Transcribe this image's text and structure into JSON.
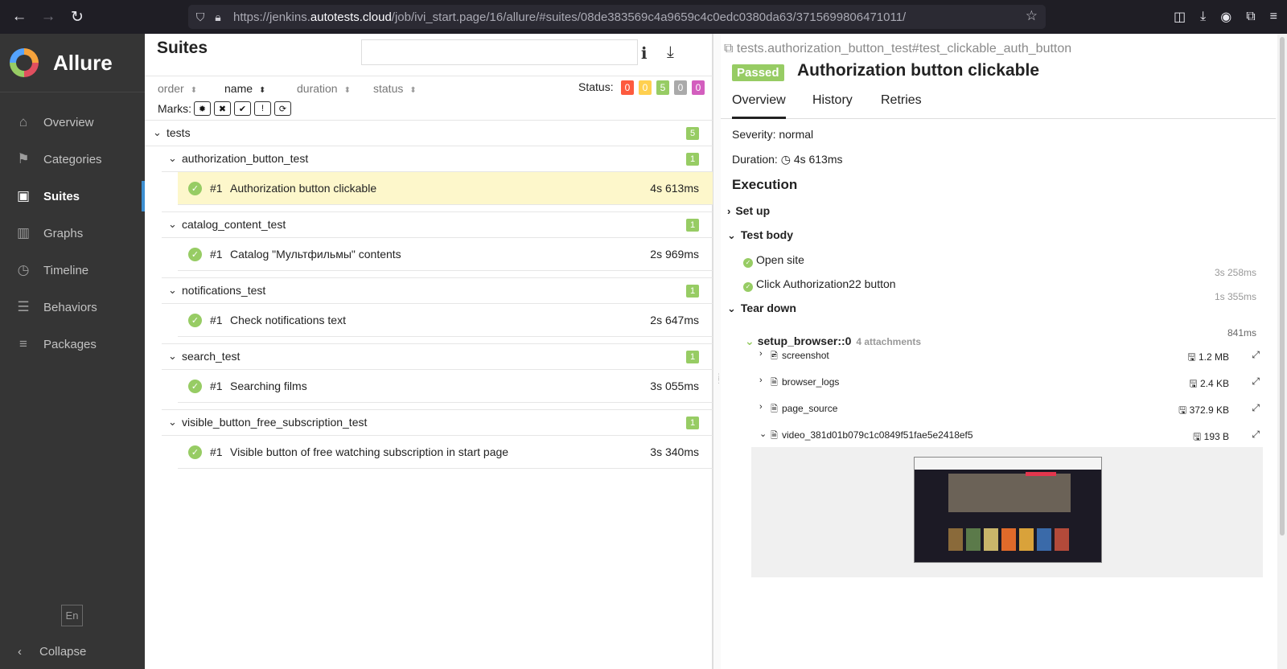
{
  "browser": {
    "url_prefix": "https://jenkins.",
    "url_host": "autotests.cloud",
    "url_path": "/job/ivi_start.page/16/allure/#suites/08de383569c4a9659c4c0edc0380da63/3715699806471011/"
  },
  "sidebar": {
    "logo": "Allure",
    "items": [
      {
        "label": "Overview",
        "icon": "home-icon"
      },
      {
        "label": "Categories",
        "icon": "flag-icon"
      },
      {
        "label": "Suites",
        "icon": "briefcase-icon"
      },
      {
        "label": "Graphs",
        "icon": "bar-chart-icon"
      },
      {
        "label": "Timeline",
        "icon": "clock-icon"
      },
      {
        "label": "Behaviors",
        "icon": "list-icon"
      },
      {
        "label": "Packages",
        "icon": "align-left-icon"
      }
    ],
    "language": "En",
    "collapse": "Collapse"
  },
  "suites": {
    "title": "Suites",
    "sort": {
      "order": "order",
      "name": "name",
      "duration": "duration",
      "status": "status"
    },
    "status_label": "Status:",
    "status_counts": [
      {
        "value": "0",
        "color": "#fd5a3e"
      },
      {
        "value": "0",
        "color": "#ffd050"
      },
      {
        "value": "5",
        "color": "#97cc64"
      },
      {
        "value": "0",
        "color": "#aaaaaa"
      },
      {
        "value": "0",
        "color": "#d35ebe"
      }
    ],
    "marks_label": "Marks:",
    "root": {
      "label": "tests",
      "count": "5"
    },
    "groups": [
      {
        "label": "authorization_button_test",
        "count": "1",
        "test": {
          "num": "#1",
          "name": "Authorization button clickable",
          "duration": "4s 613ms"
        }
      },
      {
        "label": "catalog_content_test",
        "count": "1",
        "test": {
          "num": "#1",
          "name": "Catalog \"Мультфильмы\" contents",
          "duration": "2s 969ms"
        }
      },
      {
        "label": "notifications_test",
        "count": "1",
        "test": {
          "num": "#1",
          "name": "Check notifications text",
          "duration": "2s 647ms"
        }
      },
      {
        "label": "search_test",
        "count": "1",
        "test": {
          "num": "#1",
          "name": "Searching films",
          "duration": "3s 055ms"
        }
      },
      {
        "label": "visible_button_free_subscription_test",
        "count": "1",
        "test": {
          "num": "#1",
          "name": "Visible button of free watching subscription in start page",
          "duration": "3s 340ms"
        }
      }
    ]
  },
  "detail": {
    "full_name": "tests.authorization_button_test#test_clickable_auth_button",
    "status": "Passed",
    "title": "Authorization button clickable",
    "tabs": [
      "Overview",
      "History",
      "Retries"
    ],
    "severity": "Severity: normal",
    "duration_label": "Duration:",
    "duration": "4s 613ms",
    "execution": "Execution",
    "setup": "Set up",
    "test_body": "Test body",
    "steps": [
      {
        "name": "Open site",
        "duration": "3s 258ms"
      },
      {
        "name": "Click Authorization22 button",
        "duration": "1s 355ms"
      }
    ],
    "teardown": "Tear down",
    "fixture": {
      "name": "setup_browser::0",
      "attachments": "4 attachments",
      "duration": "841ms"
    },
    "attachments": [
      {
        "name": "screenshot",
        "size": "1.2 MB"
      },
      {
        "name": "browser_logs",
        "size": "2.4 KB"
      },
      {
        "name": "page_source",
        "size": "372.9 KB"
      },
      {
        "name": "video_381d01b079c1c0849f51fae5e2418ef5",
        "size": "193 B"
      }
    ]
  }
}
